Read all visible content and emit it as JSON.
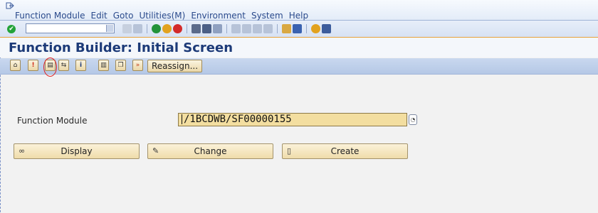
{
  "menu": {
    "items": [
      "Function Module",
      "Edit",
      "Goto",
      "Utilities(M)",
      "Environment",
      "System",
      "Help"
    ]
  },
  "title": "Function Builder: Initial Screen",
  "app_toolbar": {
    "reassign_label": "Reassign..."
  },
  "form": {
    "function_module_label": "Function Module",
    "function_module_value": "/1BCDWB/SF00000155"
  },
  "buttons": {
    "display": "Display",
    "change": "Change",
    "create": "Create"
  },
  "colors": {
    "accent_orange": "#e8a23a",
    "title_blue": "#1c3a78",
    "input_required": "#f3dea0",
    "highlight_circle": "#e21f1f"
  }
}
